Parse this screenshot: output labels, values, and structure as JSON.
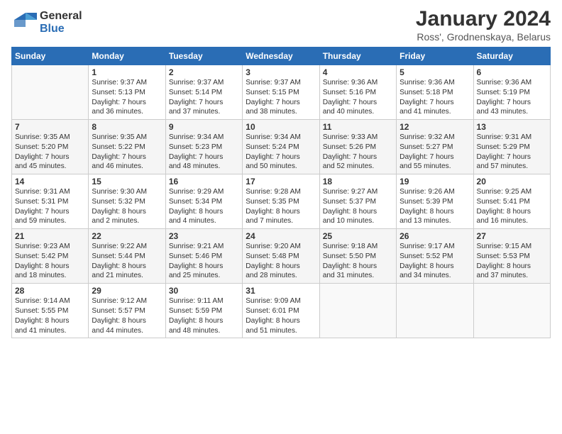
{
  "logo": {
    "general": "General",
    "blue": "Blue"
  },
  "title": "January 2024",
  "subtitle": "Ross', Grodnenskaya, Belarus",
  "days_header": [
    "Sunday",
    "Monday",
    "Tuesday",
    "Wednesday",
    "Thursday",
    "Friday",
    "Saturday"
  ],
  "weeks": [
    [
      {
        "day": "",
        "info": ""
      },
      {
        "day": "1",
        "info": "Sunrise: 9:37 AM\nSunset: 5:13 PM\nDaylight: 7 hours\nand 36 minutes."
      },
      {
        "day": "2",
        "info": "Sunrise: 9:37 AM\nSunset: 5:14 PM\nDaylight: 7 hours\nand 37 minutes."
      },
      {
        "day": "3",
        "info": "Sunrise: 9:37 AM\nSunset: 5:15 PM\nDaylight: 7 hours\nand 38 minutes."
      },
      {
        "day": "4",
        "info": "Sunrise: 9:36 AM\nSunset: 5:16 PM\nDaylight: 7 hours\nand 40 minutes."
      },
      {
        "day": "5",
        "info": "Sunrise: 9:36 AM\nSunset: 5:18 PM\nDaylight: 7 hours\nand 41 minutes."
      },
      {
        "day": "6",
        "info": "Sunrise: 9:36 AM\nSunset: 5:19 PM\nDaylight: 7 hours\nand 43 minutes."
      }
    ],
    [
      {
        "day": "7",
        "info": "Sunrise: 9:35 AM\nSunset: 5:20 PM\nDaylight: 7 hours\nand 45 minutes."
      },
      {
        "day": "8",
        "info": "Sunrise: 9:35 AM\nSunset: 5:22 PM\nDaylight: 7 hours\nand 46 minutes."
      },
      {
        "day": "9",
        "info": "Sunrise: 9:34 AM\nSunset: 5:23 PM\nDaylight: 7 hours\nand 48 minutes."
      },
      {
        "day": "10",
        "info": "Sunrise: 9:34 AM\nSunset: 5:24 PM\nDaylight: 7 hours\nand 50 minutes."
      },
      {
        "day": "11",
        "info": "Sunrise: 9:33 AM\nSunset: 5:26 PM\nDaylight: 7 hours\nand 52 minutes."
      },
      {
        "day": "12",
        "info": "Sunrise: 9:32 AM\nSunset: 5:27 PM\nDaylight: 7 hours\nand 55 minutes."
      },
      {
        "day": "13",
        "info": "Sunrise: 9:31 AM\nSunset: 5:29 PM\nDaylight: 7 hours\nand 57 minutes."
      }
    ],
    [
      {
        "day": "14",
        "info": "Sunrise: 9:31 AM\nSunset: 5:31 PM\nDaylight: 7 hours\nand 59 minutes."
      },
      {
        "day": "15",
        "info": "Sunrise: 9:30 AM\nSunset: 5:32 PM\nDaylight: 8 hours\nand 2 minutes."
      },
      {
        "day": "16",
        "info": "Sunrise: 9:29 AM\nSunset: 5:34 PM\nDaylight: 8 hours\nand 4 minutes."
      },
      {
        "day": "17",
        "info": "Sunrise: 9:28 AM\nSunset: 5:35 PM\nDaylight: 8 hours\nand 7 minutes."
      },
      {
        "day": "18",
        "info": "Sunrise: 9:27 AM\nSunset: 5:37 PM\nDaylight: 8 hours\nand 10 minutes."
      },
      {
        "day": "19",
        "info": "Sunrise: 9:26 AM\nSunset: 5:39 PM\nDaylight: 8 hours\nand 13 minutes."
      },
      {
        "day": "20",
        "info": "Sunrise: 9:25 AM\nSunset: 5:41 PM\nDaylight: 8 hours\nand 16 minutes."
      }
    ],
    [
      {
        "day": "21",
        "info": "Sunrise: 9:23 AM\nSunset: 5:42 PM\nDaylight: 8 hours\nand 18 minutes."
      },
      {
        "day": "22",
        "info": "Sunrise: 9:22 AM\nSunset: 5:44 PM\nDaylight: 8 hours\nand 21 minutes."
      },
      {
        "day": "23",
        "info": "Sunrise: 9:21 AM\nSunset: 5:46 PM\nDaylight: 8 hours\nand 25 minutes."
      },
      {
        "day": "24",
        "info": "Sunrise: 9:20 AM\nSunset: 5:48 PM\nDaylight: 8 hours\nand 28 minutes."
      },
      {
        "day": "25",
        "info": "Sunrise: 9:18 AM\nSunset: 5:50 PM\nDaylight: 8 hours\nand 31 minutes."
      },
      {
        "day": "26",
        "info": "Sunrise: 9:17 AM\nSunset: 5:52 PM\nDaylight: 8 hours\nand 34 minutes."
      },
      {
        "day": "27",
        "info": "Sunrise: 9:15 AM\nSunset: 5:53 PM\nDaylight: 8 hours\nand 37 minutes."
      }
    ],
    [
      {
        "day": "28",
        "info": "Sunrise: 9:14 AM\nSunset: 5:55 PM\nDaylight: 8 hours\nand 41 minutes."
      },
      {
        "day": "29",
        "info": "Sunrise: 9:12 AM\nSunset: 5:57 PM\nDaylight: 8 hours\nand 44 minutes."
      },
      {
        "day": "30",
        "info": "Sunrise: 9:11 AM\nSunset: 5:59 PM\nDaylight: 8 hours\nand 48 minutes."
      },
      {
        "day": "31",
        "info": "Sunrise: 9:09 AM\nSunset: 6:01 PM\nDaylight: 8 hours\nand 51 minutes."
      },
      {
        "day": "",
        "info": ""
      },
      {
        "day": "",
        "info": ""
      },
      {
        "day": "",
        "info": ""
      }
    ]
  ]
}
